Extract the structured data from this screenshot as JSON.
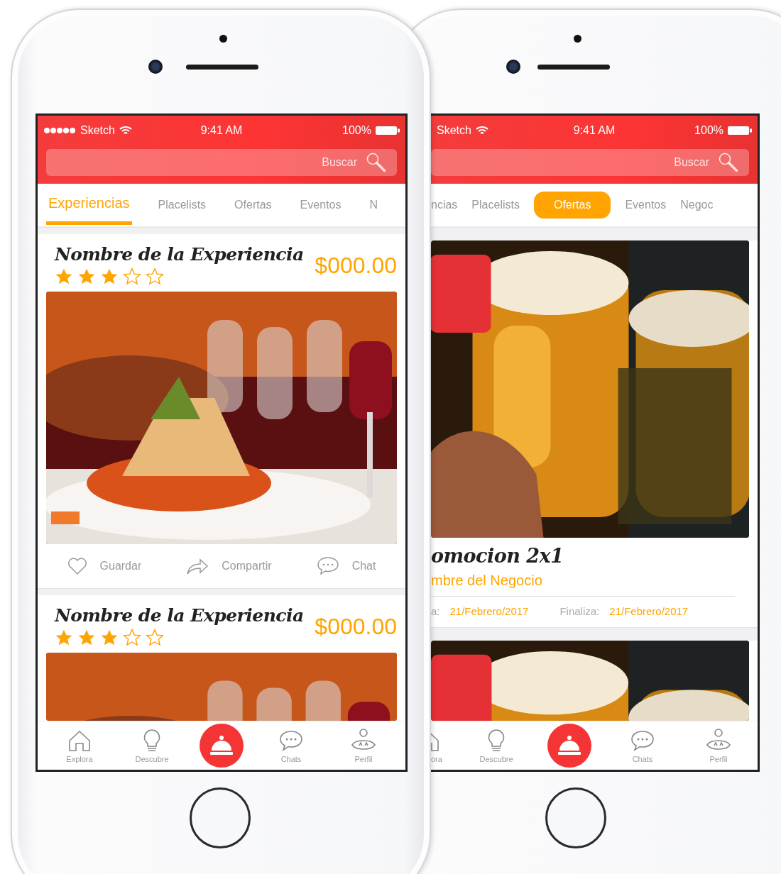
{
  "phones": [
    {
      "kind": "front",
      "status_bar": {
        "carrier": "Sketch",
        "time": "9:41 AM",
        "battery": "100%"
      },
      "search": {
        "placeholder": "Buscar"
      },
      "tabs": [
        {
          "label": "Experiencias",
          "selected": true
        },
        {
          "label": "Placelists",
          "selected": false
        },
        {
          "label": "Ofertas",
          "selected": false
        },
        {
          "label": "Eventos",
          "selected": false
        },
        {
          "label": "N",
          "selected": false
        }
      ],
      "cards": [
        {
          "kind": "experience",
          "title": "Nombre de la Experiencia",
          "stars": 3,
          "price": "$000.00",
          "actions": [
            "Guardar",
            "Compartir",
            "Chat"
          ]
        },
        {
          "kind": "experience",
          "title": "Nombre de la Experiencia",
          "stars": 3,
          "price": "$000.00"
        }
      ],
      "nav": [
        {
          "kind": "tab",
          "label": "Explora"
        },
        {
          "kind": "tab",
          "label": "Descubre"
        },
        {
          "kind": "action"
        },
        {
          "kind": "tab",
          "label": "Chats"
        },
        {
          "kind": "tab",
          "label": "Perfil"
        }
      ]
    },
    {
      "kind": "behind",
      "status_bar": {
        "carrier": "Sketch",
        "time": "9:41 AM",
        "battery": "100%"
      },
      "search": {
        "placeholder": "Buscar"
      },
      "tabs": [
        {
          "label": "ncias",
          "selected": false
        },
        {
          "label": "Placelists",
          "selected": false
        },
        {
          "label": "Ofertas",
          "selected": true
        },
        {
          "label": "Eventos",
          "selected": false
        },
        {
          "label": "Negoc",
          "selected": false
        }
      ],
      "cards": [
        {
          "kind": "offer",
          "title": "omocion 2x1",
          "business": "mbre del Negocio",
          "dates": [
            {
              "label": "a:",
              "value": "21/Febrero/2017"
            },
            {
              "label": "Finaliza:",
              "value": "21/Febrero/2017"
            }
          ]
        },
        {
          "kind": "offer"
        }
      ],
      "nav": [
        {
          "kind": "tab",
          "label": "ora"
        },
        {
          "kind": "tab",
          "label": "Descubre"
        },
        {
          "kind": "action"
        },
        {
          "kind": "tab",
          "label": "Chats"
        },
        {
          "kind": "tab",
          "label": "Perfil"
        }
      ]
    }
  ]
}
